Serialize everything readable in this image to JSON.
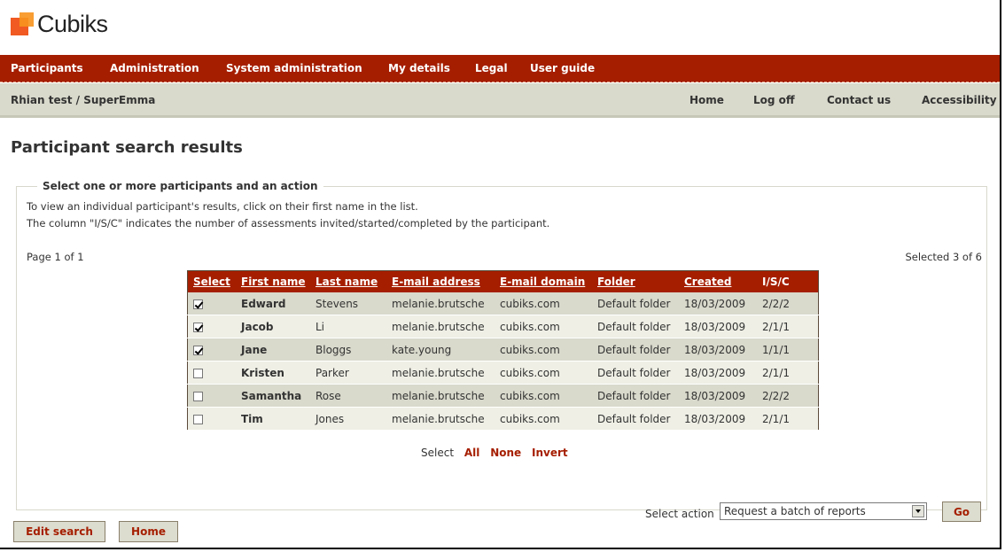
{
  "brand": {
    "name": "Cubiks"
  },
  "topnav": [
    "Participants",
    "Administration",
    "System administration",
    "My details",
    "Legal",
    "User guide"
  ],
  "subnav": {
    "user": "Rhian test / SuperEmma",
    "links": [
      "Home",
      "Log off",
      "Contact us",
      "Accessibility"
    ]
  },
  "page": {
    "title": "Participant search results"
  },
  "panel": {
    "legend": "Select one or more participants and an action",
    "info1": "To view an individual participant's results, click on their first name in the list.",
    "info2": "The column \"I/S/C\" indicates the number of assessments invited/started/completed by the participant.",
    "page_info": "Page 1 of 1",
    "selected_info": "Selected 3 of 6"
  },
  "table": {
    "headers": [
      "Select",
      "First name",
      "Last name",
      "E-mail address",
      "E-mail domain",
      "Folder",
      "Created",
      "I/S/C"
    ],
    "rows": [
      {
        "checked": true,
        "first": "Edward",
        "last": "Stevens",
        "email": "melanie.brutsche",
        "domain": "cubiks.com",
        "folder": "Default folder",
        "created": "18/03/2009",
        "isc": "2/2/2"
      },
      {
        "checked": true,
        "first": "Jacob",
        "last": "Li",
        "email": "melanie.brutsche",
        "domain": "cubiks.com",
        "folder": "Default folder",
        "created": "18/03/2009",
        "isc": "2/1/1"
      },
      {
        "checked": true,
        "first": "Jane",
        "last": "Bloggs",
        "email": "kate.young",
        "domain": "cubiks.com",
        "folder": "Default folder",
        "created": "18/03/2009",
        "isc": "1/1/1"
      },
      {
        "checked": false,
        "first": "Kristen",
        "last": "Parker",
        "email": "melanie.brutsche",
        "domain": "cubiks.com",
        "folder": "Default folder",
        "created": "18/03/2009",
        "isc": "2/1/1"
      },
      {
        "checked": false,
        "first": "Samantha",
        "last": "Rose",
        "email": "melanie.brutsche",
        "domain": "cubiks.com",
        "folder": "Default folder",
        "created": "18/03/2009",
        "isc": "2/2/2"
      },
      {
        "checked": false,
        "first": "Tim",
        "last": "Jones",
        "email": "melanie.brutsche",
        "domain": "cubiks.com",
        "folder": "Default folder",
        "created": "18/03/2009",
        "isc": "2/1/1"
      }
    ]
  },
  "selection": {
    "label": "Select",
    "all": "All",
    "none": "None",
    "invert": "Invert"
  },
  "action": {
    "label": "Select action",
    "value": "Request a batch of reports",
    "go": "Go"
  },
  "footer_buttons": {
    "edit_search": "Edit search",
    "home": "Home"
  },
  "colors": {
    "brand_red": "#a51e00",
    "logo_orange": "#f15a22",
    "subnav_bg": "#d9d9cc"
  }
}
